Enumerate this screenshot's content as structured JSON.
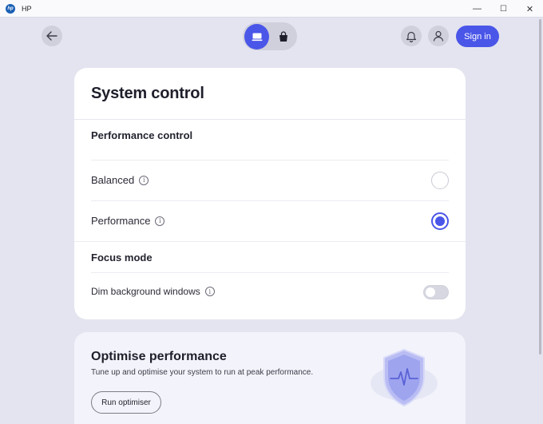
{
  "window": {
    "title": "HP",
    "logo_text": "hp",
    "minimize": "—",
    "maximize": "☐",
    "close": "✕"
  },
  "header": {
    "back_icon": "arrow-left-icon",
    "tabs": [
      {
        "icon": "laptop-icon",
        "active": true
      },
      {
        "icon": "shopping-bag-icon",
        "active": false
      }
    ],
    "notifications_icon": "bell-icon",
    "account_icon": "user-icon",
    "signin_label": "Sign in",
    "accent_color": "#4a56e8"
  },
  "system_control": {
    "title": "System control",
    "performance_section": "Performance control",
    "options": [
      {
        "label": "Balanced",
        "selected": false
      },
      {
        "label": "Performance",
        "selected": true
      }
    ],
    "focus_section": "Focus mode",
    "dim_label": "Dim background windows",
    "dim_enabled": false
  },
  "optimise": {
    "title": "Optimise performance",
    "description": "Tune up and optimise your system to run at peak performance.",
    "button_label": "Run optimiser",
    "illustration": "shield-pulse-icon"
  }
}
